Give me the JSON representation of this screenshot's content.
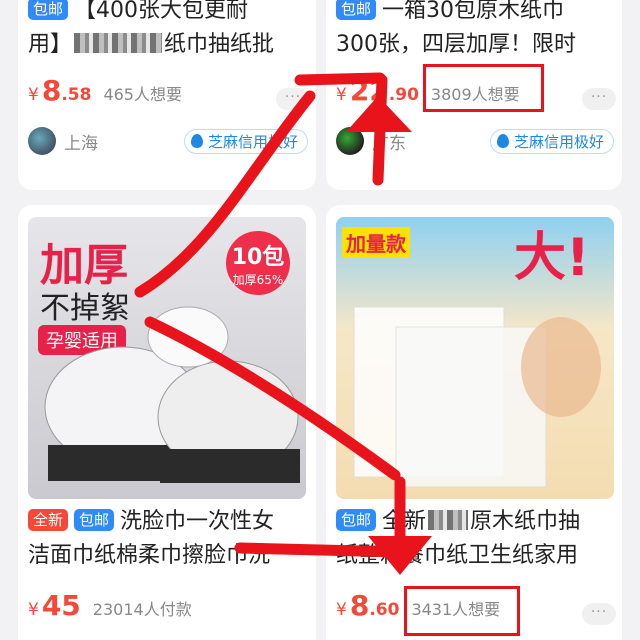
{
  "products": [
    {
      "tags": [
        "包邮"
      ],
      "title_pre": "【400张大包更耐",
      "title_line2": "用】",
      "title_line2_post": "纸巾抽纸批",
      "yen": "¥",
      "price_int": "8",
      "price_dec": ".58",
      "want": "465人想要",
      "location": "上海",
      "credit": "芝麻信用极好"
    },
    {
      "tags": [
        "包邮"
      ],
      "title_pre": "一箱30包原木纸巾",
      "title_line2": "300张，四层加厚！限时",
      "yen": "¥",
      "price_int": "22",
      "price_dec": ".90",
      "want": "3809人想要",
      "location": "广东",
      "credit": "芝麻信用极好"
    },
    {
      "tags": [
        "全新",
        "包邮"
      ],
      "title_pre": "洗脸巾一次性女",
      "title_line2": "洁面巾纸棉柔巾擦脸巾洗",
      "yen": "¥",
      "price_int": "45",
      "price_dec": "",
      "want": "23014人付款",
      "image_text": {
        "line1": "加厚",
        "line2": "不掉絮",
        "pill": "孕婴适用",
        "badge_top": "10包",
        "badge_bottom": "加厚65%"
      }
    },
    {
      "tags": [
        "包邮"
      ],
      "title_pre": "全新",
      "title_post": "原木纸巾抽",
      "title_line2": "纸整箱餐巾纸卫生纸家用",
      "yen": "¥",
      "price_int": "8",
      "price_dec": ".60",
      "want": "3431人想要",
      "image_text": {
        "left": "加量款",
        "right": "大!"
      }
    }
  ],
  "more_label": "···",
  "colors": {
    "price_red": "#f5473a",
    "tag_blue": "#2f8cf6",
    "highlight_red": "#e8131b"
  }
}
